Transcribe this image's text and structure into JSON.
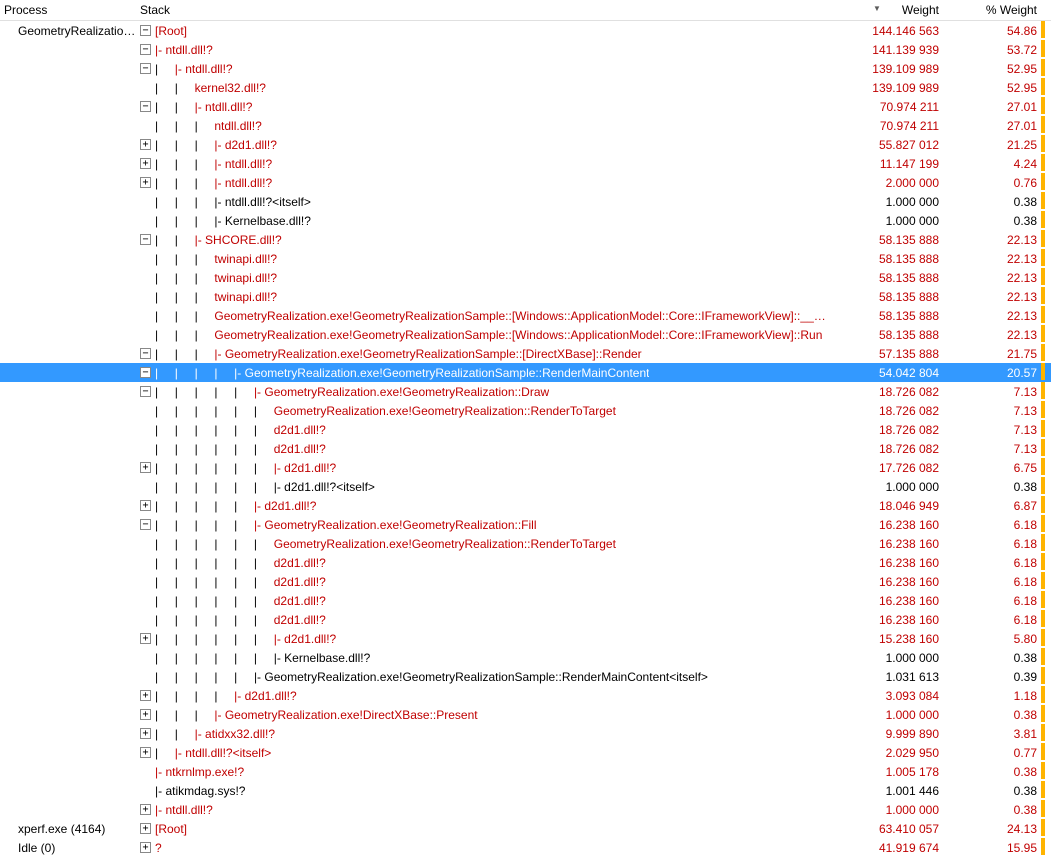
{
  "columns": {
    "process": "Process",
    "stack": "Stack",
    "weight": "Weight",
    "pct": "% Weight"
  },
  "sort_indicator": "▼",
  "rows": [
    {
      "process": "GeometryRealization...",
      "exp": "-",
      "indent": 0,
      "pipes": "",
      "label": "[Root]",
      "weight": "144.146 563",
      "pct": "54.86",
      "color": "red"
    },
    {
      "process": "",
      "exp": "-",
      "indent": 1,
      "pipes": "",
      "label": "|- ntdll.dll!?",
      "weight": "141.139 939",
      "pct": "53.72",
      "color": "red"
    },
    {
      "process": "",
      "exp": "-",
      "indent": 2,
      "pipes": "|     ",
      "label": "|- ntdll.dll!?",
      "weight": "139.109 989",
      "pct": "52.95",
      "color": "red"
    },
    {
      "process": "",
      "exp": "",
      "indent": 3,
      "pipes": "|     |     ",
      "label": "kernel32.dll!?",
      "weight": "139.109 989",
      "pct": "52.95",
      "color": "red"
    },
    {
      "process": "",
      "exp": "-",
      "indent": 3,
      "pipes": "|     |     ",
      "label": "|- ntdll.dll!?",
      "weight": "70.974 211",
      "pct": "27.01",
      "color": "red"
    },
    {
      "process": "",
      "exp": "",
      "indent": 4,
      "pipes": "|     |     |     ",
      "label": "ntdll.dll!?",
      "weight": "70.974 211",
      "pct": "27.01",
      "color": "red"
    },
    {
      "process": "",
      "exp": "+",
      "indent": 4,
      "pipes": "|     |     |     ",
      "label": "|- d2d1.dll!?",
      "weight": "55.827 012",
      "pct": "21.25",
      "color": "red"
    },
    {
      "process": "",
      "exp": "+",
      "indent": 4,
      "pipes": "|     |     |     ",
      "label": "|- ntdll.dll!?",
      "weight": "11.147 199",
      "pct": "4.24",
      "color": "red"
    },
    {
      "process": "",
      "exp": "+",
      "indent": 4,
      "pipes": "|     |     |     ",
      "label": "|- ntdll.dll!?",
      "weight": "2.000 000",
      "pct": "0.76",
      "color": "red"
    },
    {
      "process": "",
      "exp": "",
      "indent": 4,
      "pipes": "|     |     |     ",
      "label": "|- ntdll.dll!?<itself>",
      "weight": "1.000 000",
      "pct": "0.38",
      "color": "black"
    },
    {
      "process": "",
      "exp": "",
      "indent": 4,
      "pipes": "|     |     |     ",
      "label": "|- Kernelbase.dll!?",
      "weight": "1.000 000",
      "pct": "0.38",
      "color": "black"
    },
    {
      "process": "",
      "exp": "-",
      "indent": 3,
      "pipes": "|     |     ",
      "label": "|- SHCORE.dll!?",
      "weight": "58.135 888",
      "pct": "22.13",
      "color": "red"
    },
    {
      "process": "",
      "exp": "",
      "indent": 4,
      "pipes": "|     |     |     ",
      "label": "twinapi.dll!?",
      "weight": "58.135 888",
      "pct": "22.13",
      "color": "red"
    },
    {
      "process": "",
      "exp": "",
      "indent": 4,
      "pipes": "|     |     |     ",
      "label": "twinapi.dll!?",
      "weight": "58.135 888",
      "pct": "22.13",
      "color": "red"
    },
    {
      "process": "",
      "exp": "",
      "indent": 4,
      "pipes": "|     |     |     ",
      "label": "twinapi.dll!?",
      "weight": "58.135 888",
      "pct": "22.13",
      "color": "red"
    },
    {
      "process": "",
      "exp": "",
      "indent": 4,
      "pipes": "|     |     |     ",
      "label": "GeometryRealization.exe!GeometryRealizationSample::[Windows::ApplicationModel::Core::IFrameworkView]::__abi_",
      "weight": "58.135 888",
      "pct": "22.13",
      "color": "red"
    },
    {
      "process": "",
      "exp": "",
      "indent": 4,
      "pipes": "|     |     |     ",
      "label": "GeometryRealization.exe!GeometryRealizationSample::[Windows::ApplicationModel::Core::IFrameworkView]::Run",
      "weight": "58.135 888",
      "pct": "22.13",
      "color": "red"
    },
    {
      "process": "",
      "exp": "-",
      "indent": 4,
      "pipes": "|     |     |     ",
      "label": "|- GeometryRealization.exe!GeometryRealizationSample::[DirectXBase]::Render",
      "weight": "57.135 888",
      "pct": "21.75",
      "color": "red"
    },
    {
      "process": "",
      "exp": "-",
      "indent": 5,
      "pipes": "|     |     |     |     ",
      "label": "|- GeometryRealization.exe!GeometryRealizationSample::RenderMainContent",
      "weight": "54.042 804",
      "pct": "20.57",
      "color": "red",
      "selected": true
    },
    {
      "process": "",
      "exp": "-",
      "indent": 6,
      "pipes": "|     |     |     |     |     ",
      "label": "|- GeometryRealization.exe!GeometryRealization::Draw",
      "weight": "18.726 082",
      "pct": "7.13",
      "color": "red"
    },
    {
      "process": "",
      "exp": "",
      "indent": 7,
      "pipes": "|     |     |     |     |     |     ",
      "label": "GeometryRealization.exe!GeometryRealization::RenderToTarget",
      "weight": "18.726 082",
      "pct": "7.13",
      "color": "red"
    },
    {
      "process": "",
      "exp": "",
      "indent": 7,
      "pipes": "|     |     |     |     |     |     ",
      "label": "d2d1.dll!?",
      "weight": "18.726 082",
      "pct": "7.13",
      "color": "red"
    },
    {
      "process": "",
      "exp": "",
      "indent": 7,
      "pipes": "|     |     |     |     |     |     ",
      "label": "d2d1.dll!?",
      "weight": "18.726 082",
      "pct": "7.13",
      "color": "red"
    },
    {
      "process": "",
      "exp": "+",
      "indent": 7,
      "pipes": "|     |     |     |     |     |     ",
      "label": "|- d2d1.dll!?",
      "weight": "17.726 082",
      "pct": "6.75",
      "color": "red"
    },
    {
      "process": "",
      "exp": "",
      "indent": 7,
      "pipes": "|     |     |     |     |     |     ",
      "label": "|- d2d1.dll!?<itself>",
      "weight": "1.000 000",
      "pct": "0.38",
      "color": "black"
    },
    {
      "process": "",
      "exp": "+",
      "indent": 6,
      "pipes": "|     |     |     |     |     ",
      "label": "|- d2d1.dll!?",
      "weight": "18.046 949",
      "pct": "6.87",
      "color": "red"
    },
    {
      "process": "",
      "exp": "-",
      "indent": 6,
      "pipes": "|     |     |     |     |     ",
      "label": "|- GeometryRealization.exe!GeometryRealization::Fill",
      "weight": "16.238 160",
      "pct": "6.18",
      "color": "red"
    },
    {
      "process": "",
      "exp": "",
      "indent": 7,
      "pipes": "|     |     |     |     |     |     ",
      "label": "GeometryRealization.exe!GeometryRealization::RenderToTarget",
      "weight": "16.238 160",
      "pct": "6.18",
      "color": "red"
    },
    {
      "process": "",
      "exp": "",
      "indent": 7,
      "pipes": "|     |     |     |     |     |     ",
      "label": "d2d1.dll!?",
      "weight": "16.238 160",
      "pct": "6.18",
      "color": "red"
    },
    {
      "process": "",
      "exp": "",
      "indent": 7,
      "pipes": "|     |     |     |     |     |     ",
      "label": "d2d1.dll!?",
      "weight": "16.238 160",
      "pct": "6.18",
      "color": "red"
    },
    {
      "process": "",
      "exp": "",
      "indent": 7,
      "pipes": "|     |     |     |     |     |     ",
      "label": "d2d1.dll!?",
      "weight": "16.238 160",
      "pct": "6.18",
      "color": "red"
    },
    {
      "process": "",
      "exp": "",
      "indent": 7,
      "pipes": "|     |     |     |     |     |     ",
      "label": "d2d1.dll!?",
      "weight": "16.238 160",
      "pct": "6.18",
      "color": "red"
    },
    {
      "process": "",
      "exp": "+",
      "indent": 7,
      "pipes": "|     |     |     |     |     |     ",
      "label": "|- d2d1.dll!?",
      "weight": "15.238 160",
      "pct": "5.80",
      "color": "red"
    },
    {
      "process": "",
      "exp": "",
      "indent": 7,
      "pipes": "|     |     |     |     |     |     ",
      "label": "|- Kernelbase.dll!?",
      "weight": "1.000 000",
      "pct": "0.38",
      "color": "black"
    },
    {
      "process": "",
      "exp": "",
      "indent": 6,
      "pipes": "|     |     |     |     |     ",
      "label": "|- GeometryRealization.exe!GeometryRealizationSample::RenderMainContent<itself>",
      "weight": "1.031 613",
      "pct": "0.39",
      "color": "black"
    },
    {
      "process": "",
      "exp": "+",
      "indent": 5,
      "pipes": "|     |     |     |     ",
      "label": "|- d2d1.dll!?",
      "weight": "3.093 084",
      "pct": "1.18",
      "color": "red"
    },
    {
      "process": "",
      "exp": "+",
      "indent": 4,
      "pipes": "|     |     |     ",
      "label": "|- GeometryRealization.exe!DirectXBase::Present",
      "weight": "1.000 000",
      "pct": "0.38",
      "color": "red"
    },
    {
      "process": "",
      "exp": "+",
      "indent": 3,
      "pipes": "|     |     ",
      "label": "|- atidxx32.dll!?",
      "weight": "9.999 890",
      "pct": "3.81",
      "color": "red"
    },
    {
      "process": "",
      "exp": "+",
      "indent": 2,
      "pipes": "|     ",
      "label": "|- ntdll.dll!?<itself>",
      "weight": "2.029 950",
      "pct": "0.77",
      "color": "red"
    },
    {
      "process": "",
      "exp": "",
      "indent": 1,
      "pipes": "",
      "label": "|- ntkrnlmp.exe!?",
      "weight": "1.005 178",
      "pct": "0.38",
      "color": "red"
    },
    {
      "process": "",
      "exp": "",
      "indent": 1,
      "pipes": "",
      "label": "|- atikmdag.sys!?",
      "weight": "1.001 446",
      "pct": "0.38",
      "color": "black"
    },
    {
      "process": "",
      "exp": "+",
      "indent": 1,
      "pipes": "",
      "label": "|- ntdll.dll!?",
      "weight": "1.000 000",
      "pct": "0.38",
      "color": "red"
    },
    {
      "process": "xperf.exe (4164)",
      "exp": "+",
      "indent": 0,
      "pipes": "",
      "label": "[Root]",
      "weight": "63.410 057",
      "pct": "24.13",
      "color": "red"
    },
    {
      "process": "Idle (0)",
      "exp": "+",
      "indent": 0,
      "pipes": "",
      "label": "?",
      "weight": "41.919 674",
      "pct": "15.95",
      "color": "red"
    }
  ]
}
